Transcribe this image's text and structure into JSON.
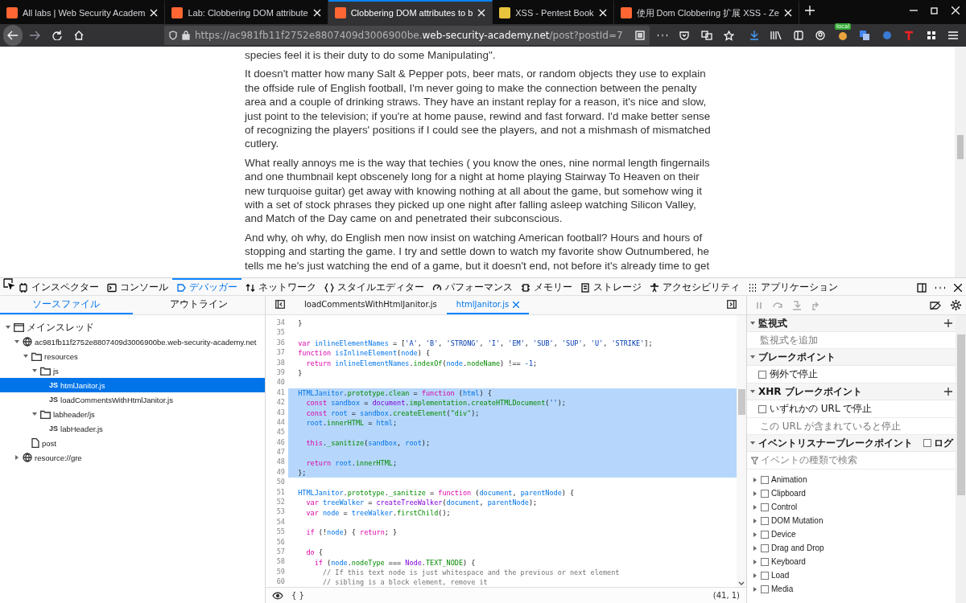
{
  "browser_tabs": [
    {
      "title": "All labs | Web Security Academ",
      "selected": false
    },
    {
      "title": "Lab: Clobbering DOM attribute",
      "selected": false
    },
    {
      "title": "Clobbering DOM attributes to b",
      "selected": true
    },
    {
      "title": "XSS - Pentest Book",
      "selected": false
    },
    {
      "title": "使用 Dom Clobbering 扩展 XSS - Ze",
      "selected": false
    }
  ],
  "address_bar": {
    "url_prefix": "https://ac981fb11f2752e8807409d3006900be.",
    "url_domain": "web-security-academy.net",
    "url_suffix": "/post?postId=7"
  },
  "extension_badge": "local",
  "article": {
    "paragraphs": [
      "species feel it is their duty to do some Manipulating\".",
      "It doesn't matter how many Salt & Pepper pots, beer mats, or random objects they use to explain the offside rule of English football, I'm never going to make the connection between the penalty area and a couple of drinking straws. They have an instant replay for a reason, it's nice and slow, just point to the television; if you're at home pause, rewind and fast forward. I'd make better sense of recognizing the players' positions if I could see the players, and not a mishmash of mismatched cutlery.",
      "What really annoys me is the way that techies ( you know the ones, nine normal length fingernails and one thumbnail kept obscenely long for a night at home playing Stairway To Heaven on their new turquoise guitar) get away with knowing nothing at all about the game, but somehow wing it with a set of stock phrases they picked up one night after falling asleep watching Silicon Valley, and Match of the Day came on and penetrated their subconscious.",
      "And why, oh why, do English men now insist on watching American football? Hours and hours of stopping and starting the game. I try and settle down to watch my favorite show Outnumbered, he tells me he's just watching the end of a game, but it doesn't end, not before it's already time to get"
    ]
  },
  "devtools": {
    "tools": [
      {
        "label": "インスペクター",
        "kind": "inspector",
        "selected": false
      },
      {
        "label": "コンソール",
        "kind": "console",
        "selected": false
      },
      {
        "label": "デバッガー",
        "kind": "debugger",
        "selected": true
      },
      {
        "label": "ネットワーク",
        "kind": "network",
        "selected": false
      },
      {
        "label": "スタイルエディター",
        "kind": "style",
        "selected": false
      },
      {
        "label": "パフォーマンス",
        "kind": "performance",
        "selected": false
      },
      {
        "label": "メモリー",
        "kind": "memory",
        "selected": false
      },
      {
        "label": "ストレージ",
        "kind": "storage",
        "selected": false
      },
      {
        "label": "アクセシビリティ",
        "kind": "accessibility",
        "selected": false
      },
      {
        "label": "アプリケーション",
        "kind": "application",
        "selected": false
      }
    ],
    "sources": {
      "tabs": [
        {
          "label": "ソースファイル",
          "selected": true
        },
        {
          "label": "アウトライン",
          "selected": false
        }
      ],
      "tree": [
        {
          "label": "メインスレッド",
          "kind": "thread",
          "expanded": true,
          "selected": false,
          "children": [
            {
              "label": "ac981fb11f2752e8807409d3006900be.web-security-academy.net",
              "kind": "domain",
              "expanded": true,
              "selected": false,
              "children": [
                {
                  "label": "resources",
                  "kind": "folder",
                  "expanded": true,
                  "selected": false,
                  "children": [
                    {
                      "label": "js",
                      "kind": "folder",
                      "expanded": true,
                      "selected": false,
                      "children": [
                        {
                          "label": "htmlJanitor.js",
                          "kind": "js",
                          "badge": "JS",
                          "selected": true
                        },
                        {
                          "label": "loadCommentsWithHtmlJanitor.js",
                          "kind": "js",
                          "badge": "JS",
                          "selected": false
                        }
                      ]
                    },
                    {
                      "label": "labheader/js",
                      "kind": "folder",
                      "expanded": true,
                      "selected": false,
                      "children": [
                        {
                          "label": "labHeader.js",
                          "kind": "js",
                          "badge": "JS",
                          "selected": false
                        }
                      ]
                    }
                  ]
                },
                {
                  "label": "post",
                  "kind": "file",
                  "selected": false
                }
              ]
            },
            {
              "label": "resource://gre",
              "kind": "domain",
              "expanded": false,
              "selected": false
            }
          ]
        }
      ]
    },
    "editor": {
      "tabs": [
        {
          "label": "loadCommentsWithHtmlJanitor.js",
          "selected": false
        },
        {
          "label": "htmlJanitor.js",
          "selected": true
        }
      ],
      "lines": [
        {
          "no": "34",
          "selected": false,
          "tokens": [
            {
              "text": "  }",
              "kind": "plain"
            }
          ]
        },
        {
          "no": "35",
          "selected": false
        },
        {
          "no": "36",
          "selected": false,
          "tokens": [
            {
              "text": "  var ",
              "kind": "keyword"
            },
            {
              "text": "inlineElementNames",
              "kind": "name"
            },
            {
              "text": " = [",
              "kind": "plain"
            },
            {
              "text": "'A'",
              "kind": "string"
            },
            {
              "text": ", ",
              "kind": "plain"
            },
            {
              "text": "'B'",
              "kind": "string"
            },
            {
              "text": ", ",
              "kind": "plain"
            },
            {
              "text": "'STRONG'",
              "kind": "string"
            },
            {
              "text": ", ",
              "kind": "plain"
            },
            {
              "text": "'I'",
              "kind": "string"
            },
            {
              "text": ", ",
              "kind": "plain"
            },
            {
              "text": "'EM'",
              "kind": "string"
            },
            {
              "text": ", ",
              "kind": "plain"
            },
            {
              "text": "'SUB'",
              "kind": "string"
            },
            {
              "text": ", ",
              "kind": "plain"
            },
            {
              "text": "'SUP'",
              "kind": "string"
            },
            {
              "text": ", ",
              "kind": "plain"
            },
            {
              "text": "'U'",
              "kind": "string"
            },
            {
              "text": ", ",
              "kind": "plain"
            },
            {
              "text": "'STRIKE'",
              "kind": "string"
            },
            {
              "text": "];",
              "kind": "plain"
            }
          ]
        },
        {
          "no": "37",
          "selected": false,
          "tokens": [
            {
              "text": "  function ",
              "kind": "keyword"
            },
            {
              "text": "isInlineElement",
              "kind": "name"
            },
            {
              "text": "(",
              "kind": "plain"
            },
            {
              "text": "node",
              "kind": "name"
            },
            {
              "text": ") {",
              "kind": "plain"
            }
          ]
        },
        {
          "no": "38",
          "selected": false,
          "tokens": [
            {
              "text": "    return ",
              "kind": "keyword"
            },
            {
              "text": "inlineElementNames",
              "kind": "name"
            },
            {
              "text": ".",
              "kind": "plain"
            },
            {
              "text": "indexOf",
              "kind": "property"
            },
            {
              "text": "(",
              "kind": "plain"
            },
            {
              "text": "node",
              "kind": "name"
            },
            {
              "text": ".",
              "kind": "plain"
            },
            {
              "text": "nodeName",
              "kind": "property"
            },
            {
              "text": ") !== ",
              "kind": "plain"
            },
            {
              "text": "-1",
              "kind": "string"
            },
            {
              "text": ";",
              "kind": "plain"
            }
          ]
        },
        {
          "no": "39",
          "selected": false,
          "tokens": [
            {
              "text": "  }",
              "kind": "plain"
            }
          ]
        },
        {
          "no": "40",
          "selected": false
        },
        {
          "no": "41",
          "selected": true,
          "tokens": [
            {
              "text": "  HTMLJanitor",
              "kind": "name"
            },
            {
              "text": ".",
              "kind": "plain"
            },
            {
              "text": "prototype",
              "kind": "property"
            },
            {
              "text": ".",
              "kind": "plain"
            },
            {
              "text": "clean",
              "kind": "property"
            },
            {
              "text": " = ",
              "kind": "plain"
            },
            {
              "text": "function ",
              "kind": "keyword"
            },
            {
              "text": "(",
              "kind": "plain"
            },
            {
              "text": "html",
              "kind": "name"
            },
            {
              "text": ") {",
              "kind": "plain"
            }
          ]
        },
        {
          "no": "42",
          "selected": true,
          "tokens": [
            {
              "text": "    const ",
              "kind": "keyword"
            },
            {
              "text": "sandbox",
              "kind": "name"
            },
            {
              "text": " = ",
              "kind": "plain"
            },
            {
              "text": "document",
              "kind": "global"
            },
            {
              "text": ".",
              "kind": "plain"
            },
            {
              "text": "implementation",
              "kind": "property"
            },
            {
              "text": ".",
              "kind": "plain"
            },
            {
              "text": "createHTMLDocument",
              "kind": "property"
            },
            {
              "text": "(",
              "kind": "plain"
            },
            {
              "text": "''",
              "kind": "string"
            },
            {
              "text": ");",
              "kind": "plain"
            }
          ]
        },
        {
          "no": "43",
          "selected": true,
          "tokens": [
            {
              "text": "    const ",
              "kind": "keyword"
            },
            {
              "text": "root",
              "kind": "name"
            },
            {
              "text": " = ",
              "kind": "plain"
            },
            {
              "text": "sandbox",
              "kind": "name"
            },
            {
              "text": ".",
              "kind": "plain"
            },
            {
              "text": "createElement",
              "kind": "property"
            },
            {
              "text": "(",
              "kind": "plain"
            },
            {
              "text": "\"div\"",
              "kind": "property"
            },
            {
              "text": ");",
              "kind": "plain"
            }
          ]
        },
        {
          "no": "44",
          "selected": true,
          "tokens": [
            {
              "text": "    root",
              "kind": "name"
            },
            {
              "text": ".",
              "kind": "plain"
            },
            {
              "text": "innerHTML",
              "kind": "property"
            },
            {
              "text": " = ",
              "kind": "plain"
            },
            {
              "text": "html",
              "kind": "name"
            },
            {
              "text": ";",
              "kind": "plain"
            }
          ]
        },
        {
          "no": "45",
          "selected": true
        },
        {
          "no": "46",
          "selected": true,
          "tokens": [
            {
              "text": "    this",
              "kind": "keyword"
            },
            {
              "text": ".",
              "kind": "plain"
            },
            {
              "text": "_sanitize",
              "kind": "property"
            },
            {
              "text": "(",
              "kind": "plain"
            },
            {
              "text": "sandbox",
              "kind": "name"
            },
            {
              "text": ", ",
              "kind": "plain"
            },
            {
              "text": "root",
              "kind": "name"
            },
            {
              "text": ");",
              "kind": "plain"
            }
          ]
        },
        {
          "no": "47",
          "selected": true
        },
        {
          "no": "48",
          "selected": true,
          "tokens": [
            {
              "text": "    return ",
              "kind": "keyword"
            },
            {
              "text": "root",
              "kind": "name"
            },
            {
              "text": ".",
              "kind": "plain"
            },
            {
              "text": "innerHTML",
              "kind": "property"
            },
            {
              "text": ";",
              "kind": "plain"
            }
          ]
        },
        {
          "no": "49",
          "selected": true,
          "tokens": [
            {
              "text": "  };",
              "kind": "plain"
            }
          ]
        },
        {
          "no": "50",
          "selected": false
        },
        {
          "no": "51",
          "selected": false,
          "tokens": [
            {
              "text": "  HTMLJanitor",
              "kind": "name"
            },
            {
              "text": ".",
              "kind": "plain"
            },
            {
              "text": "prototype",
              "kind": "property"
            },
            {
              "text": ".",
              "kind": "plain"
            },
            {
              "text": "_sanitize",
              "kind": "property"
            },
            {
              "text": " = ",
              "kind": "plain"
            },
            {
              "text": "function ",
              "kind": "keyword"
            },
            {
              "text": "(",
              "kind": "plain"
            },
            {
              "text": "document",
              "kind": "name"
            },
            {
              "text": ", ",
              "kind": "plain"
            },
            {
              "text": "parentNode",
              "kind": "name"
            },
            {
              "text": ") {",
              "kind": "plain"
            }
          ]
        },
        {
          "no": "52",
          "selected": false,
          "tokens": [
            {
              "text": "    var ",
              "kind": "keyword"
            },
            {
              "text": "treeWalker",
              "kind": "name"
            },
            {
              "text": " = ",
              "kind": "plain"
            },
            {
              "text": "createTreeWalker",
              "kind": "global"
            },
            {
              "text": "(",
              "kind": "plain"
            },
            {
              "text": "document",
              "kind": "name"
            },
            {
              "text": ", ",
              "kind": "plain"
            },
            {
              "text": "parentNode",
              "kind": "name"
            },
            {
              "text": ");",
              "kind": "plain"
            }
          ]
        },
        {
          "no": "53",
          "selected": false,
          "tokens": [
            {
              "text": "    var ",
              "kind": "keyword"
            },
            {
              "text": "node",
              "kind": "name"
            },
            {
              "text": " = ",
              "kind": "plain"
            },
            {
              "text": "treeWalker",
              "kind": "name"
            },
            {
              "text": ".",
              "kind": "plain"
            },
            {
              "text": "firstChild",
              "kind": "property"
            },
            {
              "text": "();",
              "kind": "plain"
            }
          ]
        },
        {
          "no": "54",
          "selected": false
        },
        {
          "no": "55",
          "selected": false,
          "tokens": [
            {
              "text": "    if ",
              "kind": "keyword"
            },
            {
              "text": "(!",
              "kind": "plain"
            },
            {
              "text": "node",
              "kind": "name"
            },
            {
              "text": ") { ",
              "kind": "plain"
            },
            {
              "text": "return",
              "kind": "keyword"
            },
            {
              "text": "; }",
              "kind": "plain"
            }
          ]
        },
        {
          "no": "56",
          "selected": false
        },
        {
          "no": "57",
          "selected": false,
          "tokens": [
            {
              "text": "    do ",
              "kind": "keyword"
            },
            {
              "text": "{",
              "kind": "plain"
            }
          ]
        },
        {
          "no": "58",
          "selected": false,
          "tokens": [
            {
              "text": "      if ",
              "kind": "keyword"
            },
            {
              "text": "(",
              "kind": "plain"
            },
            {
              "text": "node",
              "kind": "name"
            },
            {
              "text": ".",
              "kind": "plain"
            },
            {
              "text": "nodeType",
              "kind": "property"
            },
            {
              "text": " === ",
              "kind": "plain"
            },
            {
              "text": "Node",
              "kind": "global"
            },
            {
              "text": ".",
              "kind": "plain"
            },
            {
              "text": "TEXT_NODE",
              "kind": "property"
            },
            {
              "text": ") {",
              "kind": "plain"
            }
          ]
        },
        {
          "no": "59",
          "selected": false,
          "tokens": [
            {
              "text": "        // If this text node is just whitespace and the previous or next element",
              "kind": "comment"
            }
          ]
        },
        {
          "no": "60",
          "selected": false,
          "tokens": [
            {
              "text": "        // sibling is a block element, remove it",
              "kind": "comment"
            }
          ]
        }
      ],
      "footer": {
        "braces": "{ }",
        "position": "(41, 1)"
      }
    },
    "side_panel": {
      "watch": {
        "title": "監視式",
        "expanded": true,
        "prompt": "監視式を追加"
      },
      "breakpoints": {
        "title": "ブレークポイント",
        "expanded": true,
        "option": {
          "label": "例外で停止",
          "checked": false
        }
      },
      "xhr": {
        "title": "XHR ブレークポイント",
        "expanded": true,
        "option": {
          "label": "いずれかの URL で停止",
          "checked": false
        },
        "prompt": "この URL が含まれていると停止"
      },
      "events": {
        "title": "イベントリスナーブレークポイント",
        "expanded": true,
        "log": {
          "label": "ログ",
          "checked": false
        },
        "search_placeholder": "イベントの種類で検索",
        "categories": [
          {
            "label": "Animation",
            "expanded": false,
            "checked": false
          },
          {
            "label": "Clipboard",
            "expanded": false,
            "checked": false
          },
          {
            "label": "Control",
            "expanded": false,
            "checked": false
          },
          {
            "label": "DOM Mutation",
            "expanded": false,
            "checked": false
          },
          {
            "label": "Device",
            "expanded": false,
            "checked": false
          },
          {
            "label": "Drag and Drop",
            "expanded": false,
            "checked": false
          },
          {
            "label": "Keyboard",
            "expanded": false,
            "checked": false
          },
          {
            "label": "Load",
            "expanded": false,
            "checked": false
          },
          {
            "label": "Media",
            "expanded": false,
            "checked": false
          }
        ]
      }
    }
  }
}
